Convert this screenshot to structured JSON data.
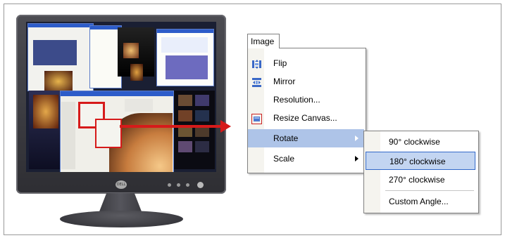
{
  "menu": {
    "title": "Image",
    "items": [
      {
        "label": "Flip",
        "icon": "flip-icon"
      },
      {
        "label": "Mirror",
        "icon": "mirror-icon"
      },
      {
        "label": "Resolution..."
      },
      {
        "label": "Resize Canvas...",
        "icon": "resize-canvas-icon"
      },
      {
        "label": "Rotate",
        "has_submenu": true,
        "selected": true
      },
      {
        "label": "Scale",
        "has_submenu": true
      }
    ]
  },
  "submenu": {
    "items": [
      {
        "label": "90° clockwise"
      },
      {
        "label": "180° clockwise",
        "selected": true
      },
      {
        "label": "270° clockwise"
      },
      {
        "label": "Custom Angle..."
      }
    ]
  },
  "monitor": {
    "brand": "DELL"
  },
  "colors": {
    "highlight": "#d61a1a",
    "selection": "#aec4e8",
    "window_title": "#2d5cc9"
  }
}
